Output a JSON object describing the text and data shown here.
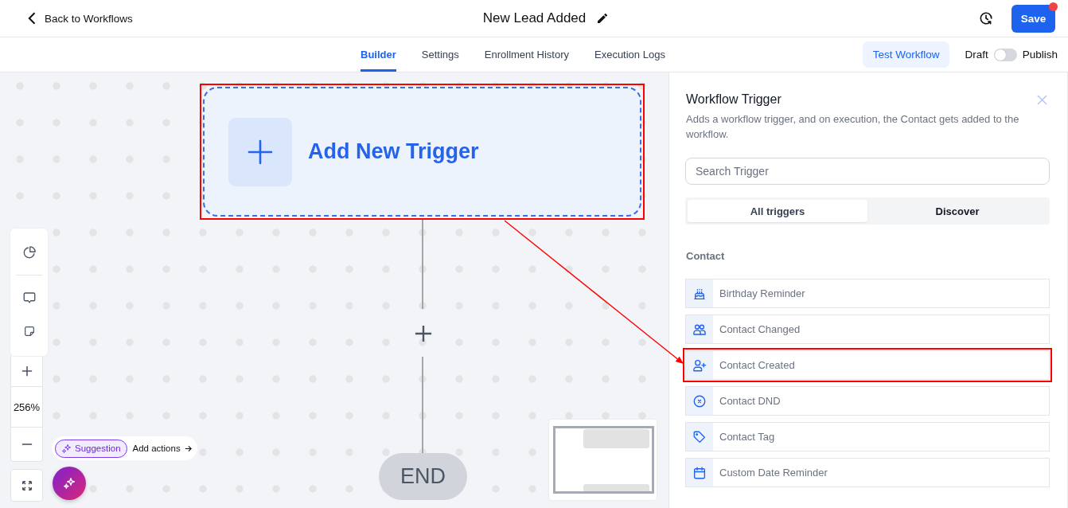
{
  "header": {
    "back_link": "Back to Workflows",
    "title": "New Lead Added",
    "save_button": "Save",
    "unsaved": true
  },
  "tabs": [
    {
      "label": "Builder",
      "selected": true
    },
    {
      "label": "Settings",
      "selected": false
    },
    {
      "label": "Enrollment History",
      "selected": false
    },
    {
      "label": "Execution Logs",
      "selected": false
    }
  ],
  "toolbar": {
    "test_button": "Test Workflow",
    "draft_label": "Draft",
    "publish_label": "Publish",
    "published": false
  },
  "canvas": {
    "trigger_node": {
      "label": "Add New Trigger",
      "highlighted": true
    },
    "end_node": "END",
    "zoom_level": "256%",
    "suggestion": {
      "chip": "Suggestion",
      "link": "Add actions"
    }
  },
  "panel": {
    "title": "Workflow Trigger",
    "description": "Adds a workflow trigger, and on execution, the Contact gets added to the workflow.",
    "search": {
      "placeholder": "Search Trigger"
    },
    "segments": [
      {
        "label": "All triggers",
        "selected": true
      },
      {
        "label": "Discover",
        "selected": false
      }
    ],
    "section": "Contact",
    "triggers": [
      {
        "label": "Birthday Reminder",
        "kind": "birthday",
        "highlighted": false
      },
      {
        "label": "Contact Changed",
        "kind": "changed",
        "highlighted": false
      },
      {
        "label": "Contact Created",
        "kind": "created",
        "highlighted": true
      },
      {
        "label": "Contact DND",
        "kind": "dnd",
        "highlighted": false
      },
      {
        "label": "Contact Tag",
        "kind": "tag",
        "highlighted": false
      },
      {
        "label": "Custom Date Reminder",
        "kind": "date",
        "highlighted": false
      }
    ]
  }
}
